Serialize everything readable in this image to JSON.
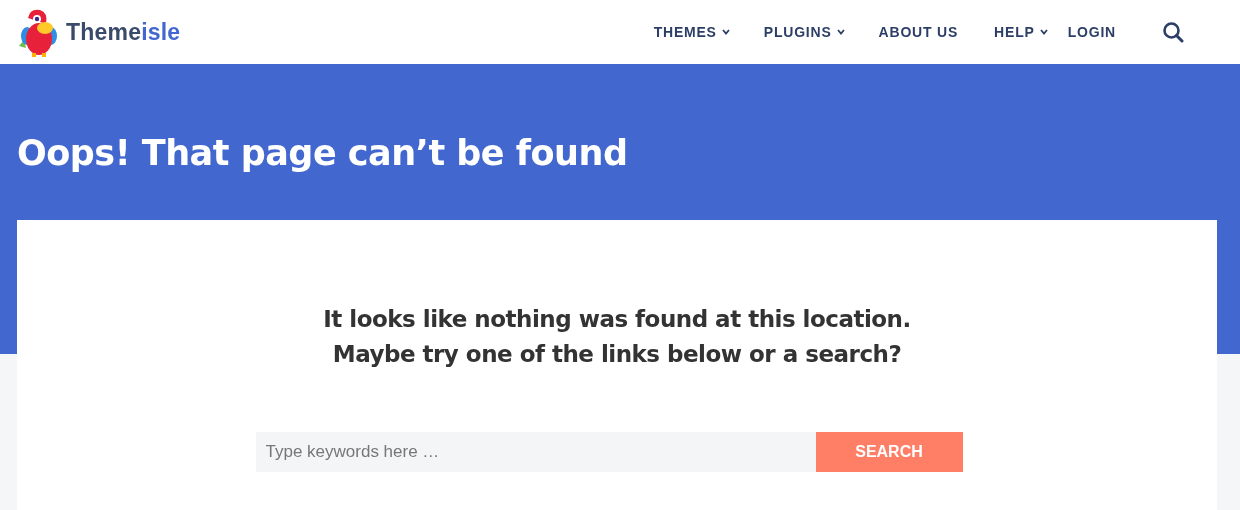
{
  "logo": {
    "text_main": "Theme",
    "text_accent": "isle"
  },
  "nav": [
    {
      "label": "THEMES",
      "has_dropdown": true
    },
    {
      "label": "PLUGINS",
      "has_dropdown": true
    },
    {
      "label": "ABOUT US",
      "has_dropdown": false
    },
    {
      "label": "HELP",
      "has_dropdown": true
    },
    {
      "label": "LOGIN",
      "has_dropdown": false
    }
  ],
  "title": "Oops! That page can’t be found",
  "message": [
    "It looks like nothing was found at this location.",
    "Maybe try one of the links below or a search?"
  ],
  "search": {
    "placeholder": "Type keywords here …",
    "button": "SEARCH"
  }
}
